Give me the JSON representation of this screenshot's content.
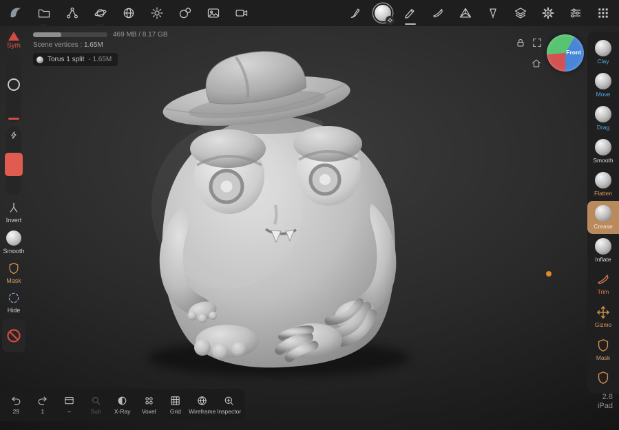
{
  "top_bar": {
    "left_icons": [
      "app-logo",
      "files",
      "scene-graph",
      "primitives",
      "environment",
      "lighting",
      "matcap",
      "image",
      "camera"
    ],
    "right_icons": [
      "paint",
      "current-material-sphere",
      "pencil",
      "knife",
      "topology",
      "cone",
      "layers",
      "settings-gear",
      "sliders",
      "interface-grid"
    ],
    "material_selected": true
  },
  "stats": {
    "memory_text": "469 MB / 8.17 GB",
    "memory_fill_percent": 38,
    "scene_vertices_label": "Scene vertices :",
    "scene_vertices_value": "1.65M",
    "object_name": "Torus 1 split",
    "object_vertices": "- 1.65M"
  },
  "left_panel": {
    "sym_label": "Sym",
    "invert_label": "Invert",
    "smooth_label": "Smooth",
    "mask_label": "Mask",
    "hide_label": "Hide"
  },
  "right_toolbar": {
    "tools": [
      {
        "label": "Clay",
        "color": "#55a8e2"
      },
      {
        "label": "Move",
        "color": "#55a8e2"
      },
      {
        "label": "Drag",
        "color": "#55a8e2"
      },
      {
        "label": "Smooth",
        "color": "#d8d8d8"
      },
      {
        "label": "Flatten",
        "color": "#e39a55"
      },
      {
        "label": "Crease",
        "color": "#ffe2c2",
        "selected": true
      },
      {
        "label": "Inflate",
        "color": "#d8d8d8"
      },
      {
        "label": "Trim",
        "color": "#e2794e"
      },
      {
        "label": "Gizmo",
        "color": "#e39a55"
      },
      {
        "label": "Mask",
        "color": "#caa06b"
      }
    ]
  },
  "bottom_bar": {
    "undo_count": "29",
    "redo_count": "1",
    "card_label": "–",
    "sub_label": "Sub",
    "buttons": [
      "X-Ray",
      "Voxel",
      "Grid",
      "Wireframe",
      "Inspector"
    ]
  },
  "viewport": {
    "orientation_label": "Front",
    "version": "2.8",
    "device_label": "iPad"
  },
  "colors": {
    "topbar_bg": "#1e1e1e",
    "panel_bg": "#1f1f1f",
    "selected_tool_bg": "#b98a5e",
    "symmetry_red": "#e25749",
    "label_blue": "#55a8e2",
    "label_orange": "#e39a55",
    "indicator_orange": "#e0872e"
  }
}
